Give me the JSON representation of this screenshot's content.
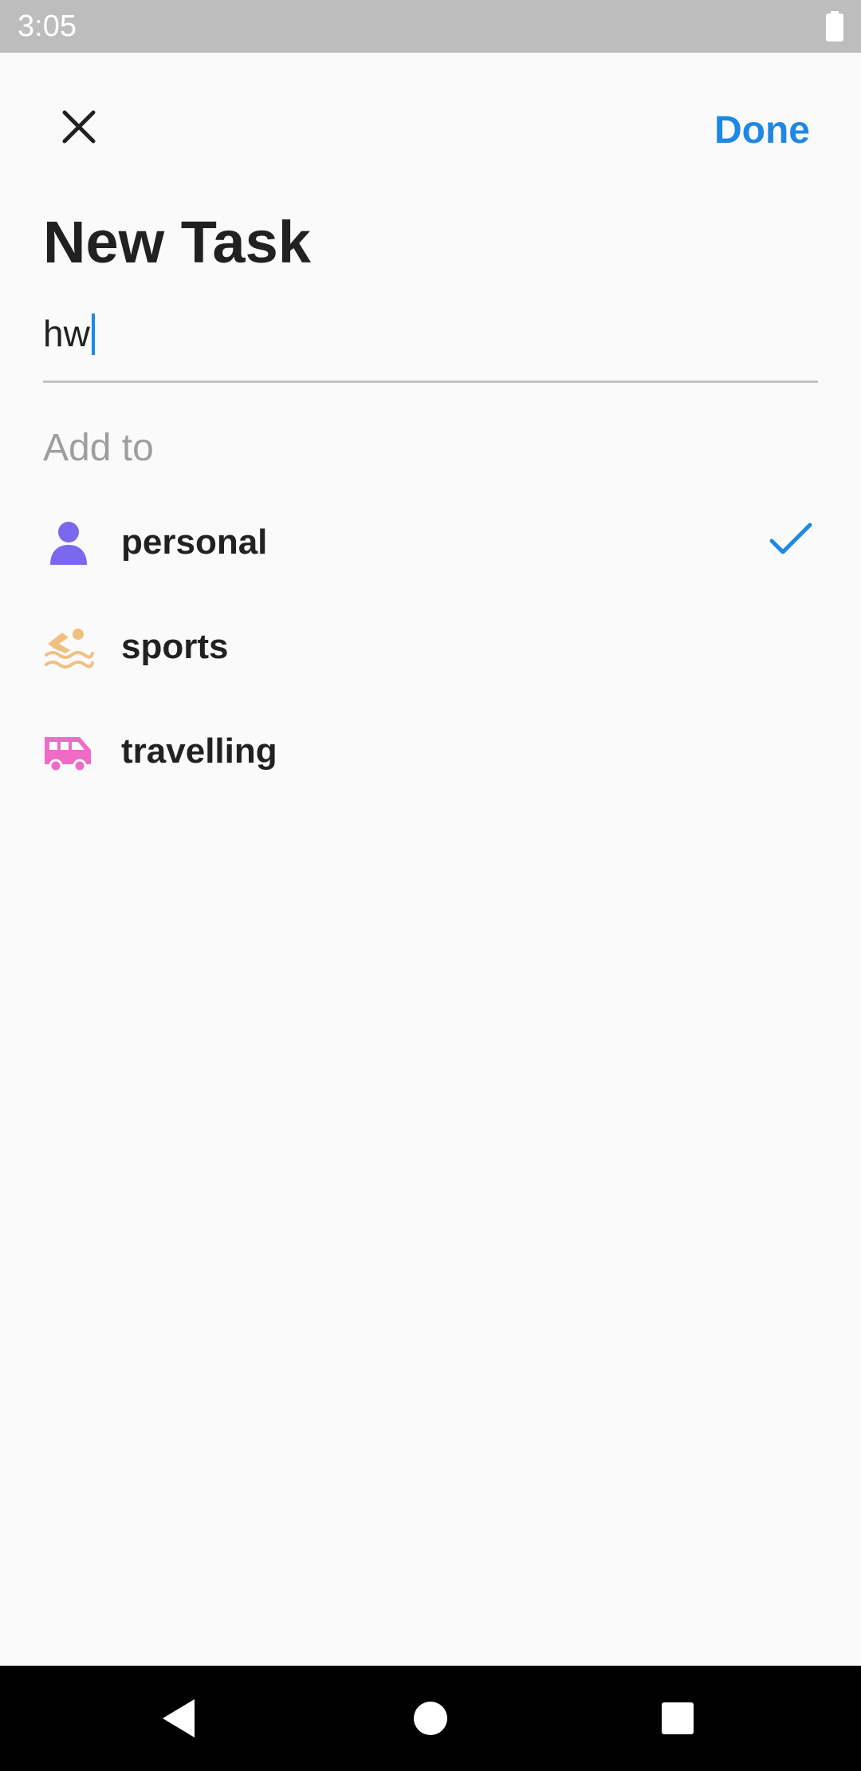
{
  "status_bar": {
    "time": "3:05",
    "battery_icon": "battery-full-icon"
  },
  "header": {
    "close_icon": "close-icon",
    "done_label": "Done"
  },
  "title": "New Task",
  "task_input": {
    "value": "hw"
  },
  "section_label": "Add to",
  "lists": [
    {
      "label": "personal",
      "icon": "person-icon",
      "color": "#7b68ee",
      "selected": true
    },
    {
      "label": "sports",
      "icon": "swimming-icon",
      "color": "#f0c080",
      "selected": false
    },
    {
      "label": "travelling",
      "icon": "van-icon",
      "color": "#f06ac8",
      "selected": false
    }
  ],
  "colors": {
    "accent": "#1e88e5",
    "background": "#fafafa",
    "status_bar": "#bdbdbd",
    "nav_bar": "#000000"
  },
  "nav": {
    "back_icon": "back-icon",
    "home_icon": "home-icon",
    "recents_icon": "recents-icon"
  }
}
